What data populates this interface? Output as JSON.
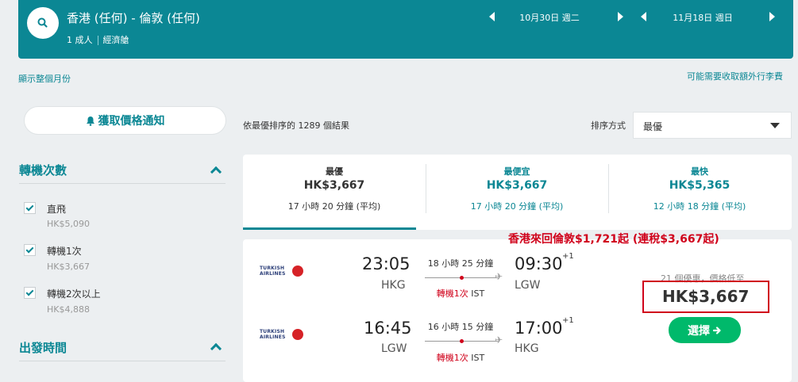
{
  "header": {
    "route": "香港 (任何) - 倫敦 (任何)",
    "passengers": "1 成人",
    "cabin": "經濟艙",
    "depart_date": "10月30日 週二",
    "return_date": "11月18日 週日"
  },
  "links": {
    "show_month": "顯示整個月份",
    "baggage_fee": "可能需要收取額外行李費"
  },
  "price_alert_label": "獲取價格通知",
  "filters": {
    "stops_title": "轉機次數",
    "options": [
      {
        "label": "直飛",
        "price": "HK$5,090"
      },
      {
        "label": "轉機1次",
        "price": "HK$3,667"
      },
      {
        "label": "轉機2次以上",
        "price": "HK$4,888"
      }
    ],
    "departure_title": "出發時間"
  },
  "results": {
    "count_prefix": "依最優排序的",
    "count": "1289",
    "count_suffix": "個結果",
    "sort_label": "排序方式",
    "sort_value": "最優"
  },
  "sort_tabs": [
    {
      "label": "最優",
      "price": "HK$3,667",
      "duration": "17 小時 20 分鐘 (平均)"
    },
    {
      "label": "最便宜",
      "price": "HK$3,667",
      "duration": "17 小時 20 分鐘 (平均)"
    },
    {
      "label": "最快",
      "price": "HK$5,365",
      "duration": "12 小時 18 分鐘 (平均)"
    }
  ],
  "annotation": "香港來回倫敦$1,721起 (連稅$3,667起)",
  "result_card": {
    "airline_name_1": "TURKISH",
    "airline_name_2": "AIRLINES",
    "outbound": {
      "depart_time": "23:05",
      "depart_airport": "HKG",
      "duration": "18 小時 25 分鐘",
      "stops": "轉機1次",
      "via": "IST",
      "arrive_time": "09:30",
      "arrive_day": "+1",
      "arrive_airport": "LGW"
    },
    "inbound": {
      "depart_time": "16:45",
      "depart_airport": "LGW",
      "duration": "16 小時 15 分鐘",
      "stops": "轉機1次",
      "via": "IST",
      "arrive_time": "17:00",
      "arrive_day": "+1",
      "arrive_airport": "HKG"
    },
    "deals_text": "21 個優惠，價格低至",
    "price": "HK$3,667",
    "select_label": "選擇"
  },
  "colors": {
    "brand": "#0b8794",
    "accent_red": "#d0021b",
    "cta_green": "#00b96b"
  }
}
